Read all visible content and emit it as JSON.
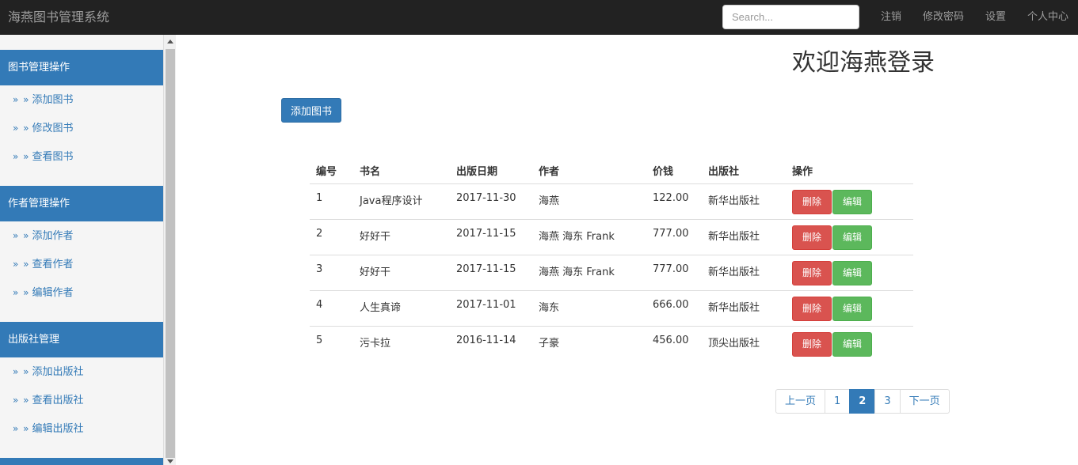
{
  "navbar": {
    "brand": "海燕图书管理系统",
    "search_placeholder": "Search...",
    "links": [
      "注销",
      "修改密码",
      "设置",
      "个人中心"
    ]
  },
  "sidebar": {
    "sections": [
      {
        "title": "图书管理操作",
        "items": [
          "添加图书",
          "修改图书",
          "查看图书"
        ]
      },
      {
        "title": "作者管理操作",
        "items": [
          "添加作者",
          "查看作者",
          "编辑作者"
        ]
      },
      {
        "title": "出版社管理",
        "items": [
          "添加出版社",
          "查看出版社",
          "编辑出版社"
        ]
      }
    ],
    "item_prefix": "» »"
  },
  "main": {
    "welcome": "欢迎海燕登录",
    "add_button": "添加图书",
    "table": {
      "headers": [
        "编号",
        "书名",
        "出版日期",
        "作者",
        "价钱",
        "出版社",
        "操作"
      ],
      "rows": [
        [
          "1",
          "Java程序设计",
          "2017-11-30",
          "海燕",
          "122.00",
          "新华出版社"
        ],
        [
          "2",
          "好好干",
          "2017-11-15",
          "海燕 海东 Frank",
          "777.00",
          "新华出版社"
        ],
        [
          "3",
          "好好干",
          "2017-11-15",
          "海燕 海东 Frank",
          "777.00",
          "新华出版社"
        ],
        [
          "4",
          "人生真谛",
          "2017-11-01",
          "海东",
          "666.00",
          "新华出版社"
        ],
        [
          "5",
          "污卡拉",
          "2016-11-14",
          "子豪",
          "456.00",
          "顶尖出版社"
        ]
      ],
      "delete_label": "删除",
      "edit_label": "编辑"
    },
    "pagination": {
      "prev": "上一页",
      "pages": [
        "1",
        "2",
        "3"
      ],
      "active": "2",
      "next": "下一页"
    }
  },
  "colors": {
    "navbar_bg": "#222222",
    "primary": "#337ab7",
    "danger": "#d9534f",
    "success": "#5cb85c"
  }
}
